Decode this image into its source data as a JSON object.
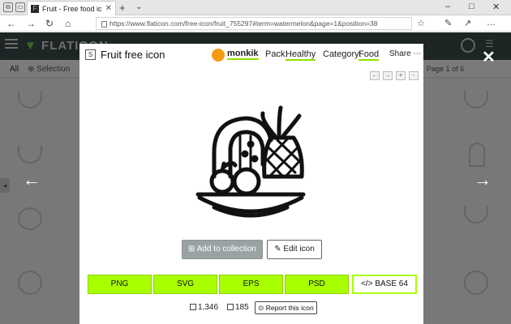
{
  "browser": {
    "tab_title": "Fruit - Free food icons",
    "tab_close": "✕",
    "new_tab": "+",
    "url": "https://www.flaticon.com/free-icon/fruit_755297#term=watermelon&page=1&position=38",
    "nav": {
      "back": "←",
      "forward": "→",
      "refresh": "↻",
      "home": "⌂"
    },
    "window": {
      "minimize": "–",
      "maximize": "□",
      "close": "✕"
    },
    "icons": {
      "favorite": "☆",
      "reading": "✎",
      "share": "↗",
      "more": "…"
    }
  },
  "site": {
    "logo": "FLATICON",
    "tab_all": "All",
    "tab_selection": "Selection",
    "page_label": "Page",
    "page_value": "1",
    "page_of": "of 6"
  },
  "modal": {
    "title": "Fruit free icon",
    "author": "monkik",
    "pack_label": "Pack:",
    "pack_value": "Healthy",
    "category_label": "Category:",
    "category_value": "Food",
    "share_label": "Share",
    "add_collection": "Add to collection",
    "edit_icon": "Edit icon",
    "formats": [
      "PNG",
      "SVG",
      "EPS",
      "PSD"
    ],
    "base64": "</> BASE 64",
    "downloads": "1,346",
    "collections": "185",
    "report": "Report this icon",
    "view_controls": [
      "←",
      "→",
      "+",
      "-"
    ]
  },
  "overlay": {
    "prev": "←",
    "next": "→",
    "close": "✕"
  },
  "colors": {
    "accent": "#a8ff00",
    "header_bg": "#3b4a4a",
    "overlay": "rgba(0,0,0,0.5)"
  }
}
